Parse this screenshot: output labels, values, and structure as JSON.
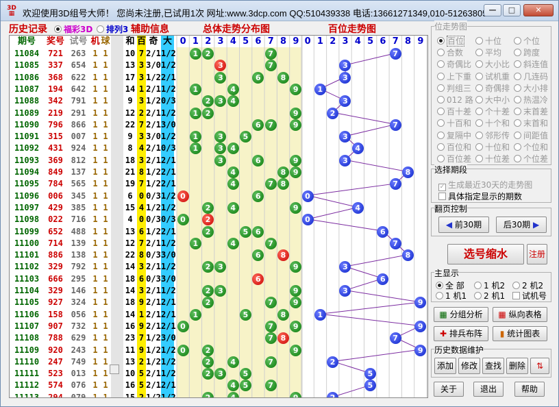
{
  "window": {
    "title": "欢迎使用3D组号大师！ 您尚未注册,已试用1次 网址:www.3dcp.com QQ:510439338 电话:13661271349,010-51263805",
    "logo": "3D",
    "min": "—",
    "max": "□",
    "close": "✕"
  },
  "headers": {
    "history": "历史记录",
    "fc3d": "福彩3D",
    "pl3": "排列3",
    "aux": "辅助信息",
    "overall": "总体走势分布图",
    "hundred": "百位走势图"
  },
  "columns": {
    "issue": "期号",
    "prize": "奖号",
    "trial": "试号",
    "machine": "机",
    "ball": "球",
    "sum": "和",
    "hundred": "百",
    "odd": "奇",
    "big": "大",
    "digits": [
      "0",
      "1",
      "2",
      "3",
      "4",
      "5",
      "6",
      "7",
      "8",
      "9"
    ]
  },
  "rows": [
    {
      "issue": "11084",
      "prize": "721",
      "trial": "263",
      "m": "1",
      "b": "1",
      "sum": "10",
      "h": "7",
      "odd": "2/1",
      "big": "1/2",
      "balls": [
        1,
        2,
        7
      ],
      "red": [],
      "hp": 7,
      "hh": 3
    },
    {
      "issue": "11085",
      "prize": "337",
      "trial": "654",
      "m": "1",
      "b": "1",
      "sum": "13",
      "h": "3",
      "odd": "3/0",
      "big": "1/2",
      "balls": [
        3,
        7
      ],
      "red": [
        3
      ],
      "hp": 3,
      "hh": 0
    },
    {
      "issue": "11086",
      "prize": "368",
      "trial": "622",
      "m": "1",
      "b": "1",
      "sum": "17",
      "h": "3",
      "odd": "1/2",
      "big": "2/1",
      "balls": [
        3,
        6,
        8
      ],
      "red": [],
      "hp": 3,
      "hh": 0
    },
    {
      "issue": "11087",
      "prize": "194",
      "trial": "642",
      "m": "1",
      "b": "1",
      "sum": "14",
      "h": "1",
      "odd": "2/1",
      "big": "1/2",
      "balls": [
        1,
        4,
        9
      ],
      "red": [],
      "hp": 1,
      "hh": 0
    },
    {
      "issue": "11088",
      "prize": "342",
      "trial": "791",
      "m": "1",
      "b": "1",
      "sum": "9",
      "h": "3",
      "odd": "1/2",
      "big": "0/3",
      "balls": [
        2,
        3,
        4
      ],
      "red": [],
      "hp": 3,
      "hh": 0
    },
    {
      "issue": "11089",
      "prize": "219",
      "trial": "291",
      "m": "1",
      "b": "1",
      "sum": "12",
      "h": "2",
      "odd": "2/1",
      "big": "1/2",
      "balls": [
        1,
        2,
        9
      ],
      "red": [],
      "hp": 2,
      "hh": 0
    },
    {
      "issue": "11090",
      "prize": "796",
      "trial": "866",
      "m": "1",
      "b": "1",
      "sum": "22",
      "h": "7",
      "odd": "2/1",
      "big": "3/0",
      "balls": [
        6,
        7,
        9
      ],
      "red": [],
      "hp": 7,
      "hh": 0
    },
    {
      "issue": "11091",
      "prize": "315",
      "trial": "007",
      "m": "1",
      "b": "1",
      "sum": "9",
      "h": "3",
      "odd": "3/0",
      "big": "1/2",
      "balls": [
        1,
        3,
        5
      ],
      "red": [],
      "hp": 3,
      "hh": 0
    },
    {
      "issue": "11092",
      "prize": "431",
      "trial": "924",
      "m": "1",
      "b": "1",
      "sum": "8",
      "h": "4",
      "odd": "2/1",
      "big": "0/3",
      "balls": [
        1,
        3,
        4
      ],
      "red": [],
      "hp": 4,
      "hh": 0
    },
    {
      "issue": "11093",
      "prize": "369",
      "trial": "812",
      "m": "1",
      "b": "1",
      "sum": "18",
      "h": "3",
      "odd": "2/1",
      "big": "2/1",
      "balls": [
        3,
        6,
        9
      ],
      "red": [],
      "hp": 3,
      "hh": 0
    },
    {
      "issue": "11094",
      "prize": "849",
      "trial": "137",
      "m": "1",
      "b": "1",
      "sum": "21",
      "h": "8",
      "odd": "1/2",
      "big": "2/1",
      "balls": [
        4,
        8,
        9
      ],
      "red": [],
      "hp": 8,
      "hh": 0
    },
    {
      "issue": "11095",
      "prize": "784",
      "trial": "565",
      "m": "1",
      "b": "1",
      "sum": "19",
      "h": "7",
      "odd": "1/2",
      "big": "2/1",
      "balls": [
        4,
        7,
        8
      ],
      "red": [],
      "hp": 7,
      "hh": 0
    },
    {
      "issue": "11096",
      "prize": "006",
      "trial": "345",
      "m": "1",
      "b": "1",
      "sum": "6",
      "h": "0",
      "odd": "0/3",
      "big": "1/2",
      "balls": [
        0,
        6
      ],
      "red": [
        0
      ],
      "hp": 0,
      "hh": 0
    },
    {
      "issue": "11097",
      "prize": "429",
      "trial": "385",
      "m": "1",
      "b": "1",
      "sum": "15",
      "h": "4",
      "odd": "1/2",
      "big": "1/2",
      "balls": [
        2,
        4,
        9
      ],
      "red": [],
      "hp": 4,
      "hh": 0
    },
    {
      "issue": "11098",
      "prize": "022",
      "trial": "716",
      "m": "1",
      "b": "1",
      "sum": "4",
      "h": "0",
      "odd": "0/3",
      "big": "0/3",
      "balls": [
        0,
        2
      ],
      "red": [
        2
      ],
      "hp": 0,
      "hh": 0
    },
    {
      "issue": "11099",
      "prize": "652",
      "trial": "488",
      "m": "1",
      "b": "1",
      "sum": "13",
      "h": "6",
      "odd": "1/2",
      "big": "2/1",
      "balls": [
        2,
        5,
        6
      ],
      "red": [],
      "hp": 6,
      "hh": 0
    },
    {
      "issue": "11100",
      "prize": "714",
      "trial": "139",
      "m": "1",
      "b": "1",
      "sum": "12",
      "h": "7",
      "odd": "2/1",
      "big": "1/2",
      "balls": [
        1,
        4,
        7
      ],
      "red": [],
      "hp": 7,
      "hh": 0
    },
    {
      "issue": "11101",
      "prize": "886",
      "trial": "138",
      "m": "1",
      "b": "1",
      "sum": "22",
      "h": "8",
      "odd": "0/3",
      "big": "3/0",
      "balls": [
        6,
        8
      ],
      "red": [
        8
      ],
      "hp": 8,
      "hh": 0
    },
    {
      "issue": "11102",
      "prize": "329",
      "trial": "792",
      "m": "1",
      "b": "1",
      "sum": "14",
      "h": "3",
      "odd": "2/1",
      "big": "1/2",
      "balls": [
        2,
        3,
        9
      ],
      "red": [],
      "hp": 3,
      "hh": 0
    },
    {
      "issue": "11103",
      "prize": "666",
      "trial": "295",
      "m": "1",
      "b": "1",
      "sum": "18",
      "h": "6",
      "odd": "0/3",
      "big": "3/0",
      "balls": [
        6
      ],
      "red": [
        6
      ],
      "hp": 6,
      "hh": 0
    },
    {
      "issue": "11104",
      "prize": "329",
      "trial": "146",
      "m": "1",
      "b": "1",
      "sum": "14",
      "h": "3",
      "odd": "2/1",
      "big": "1/2",
      "balls": [
        2,
        3,
        9
      ],
      "red": [],
      "hp": 3,
      "hh": 0
    },
    {
      "issue": "11105",
      "prize": "927",
      "trial": "324",
      "m": "1",
      "b": "1",
      "sum": "18",
      "h": "9",
      "odd": "2/1",
      "big": "2/1",
      "balls": [
        2,
        7,
        9
      ],
      "red": [],
      "hp": 9,
      "hh": 0
    },
    {
      "issue": "11106",
      "prize": "158",
      "trial": "056",
      "m": "1",
      "b": "1",
      "sum": "14",
      "h": "1",
      "odd": "2/1",
      "big": "2/1",
      "balls": [
        1,
        5,
        8
      ],
      "red": [],
      "hp": 1,
      "hh": 0
    },
    {
      "issue": "11107",
      "prize": "907",
      "trial": "732",
      "m": "1",
      "b": "1",
      "sum": "16",
      "h": "9",
      "odd": "2/1",
      "big": "2/1",
      "balls": [
        0,
        7,
        9
      ],
      "red": [],
      "hp": 9,
      "hh": 0
    },
    {
      "issue": "11108",
      "prize": "788",
      "trial": "629",
      "m": "1",
      "b": "1",
      "sum": "23",
      "h": "7",
      "odd": "1/2",
      "big": "3/0",
      "balls": [
        7,
        8
      ],
      "red": [
        8
      ],
      "hp": 7,
      "hh": 0
    },
    {
      "issue": "11109",
      "prize": "920",
      "trial": "243",
      "m": "1",
      "b": "1",
      "sum": "11",
      "h": "9",
      "odd": "1/2",
      "big": "1/2",
      "balls": [
        0,
        2,
        9
      ],
      "red": [],
      "hp": 9,
      "hh": 0
    },
    {
      "issue": "11110",
      "prize": "247",
      "trial": "749",
      "m": "1",
      "b": "1",
      "sum": "13",
      "h": "2",
      "odd": "1/2",
      "big": "1/2",
      "balls": [
        2,
        4,
        7
      ],
      "red": [],
      "hp": 2,
      "hh": 0
    },
    {
      "issue": "11111",
      "prize": "523",
      "trial": "013",
      "m": "1",
      "b": "1",
      "sum": "10",
      "h": "5",
      "odd": "2/1",
      "big": "1/2",
      "balls": [
        2,
        3,
        5
      ],
      "red": [],
      "hp": 5,
      "hh": 0
    },
    {
      "issue": "11112",
      "prize": "574",
      "trial": "076",
      "m": "1",
      "b": "1",
      "sum": "16",
      "h": "5",
      "odd": "2/1",
      "big": "2/1",
      "balls": [
        4,
        5,
        7
      ],
      "red": [],
      "hp": 5,
      "hh": 0
    },
    {
      "issue": "11113",
      "prize": "294",
      "trial": "079",
      "m": "1",
      "b": "1",
      "sum": "15",
      "h": "2",
      "odd": "1/2",
      "big": "1/2",
      "balls": [
        2,
        4,
        9
      ],
      "red": [],
      "hp": 2,
      "hh": 0
    }
  ],
  "position_panel": {
    "title": "位走势图",
    "options": [
      "百位",
      "十位",
      "个位",
      "合数",
      "平均",
      "跨度",
      "奇偶比",
      "大小比",
      "斜连值",
      "上下重",
      "试机重",
      "几连码",
      "判组三",
      "奇偶排",
      "大小排",
      "012 路",
      "大中小",
      "热温冷",
      "百十差",
      "个十差",
      "末首差",
      "十百和",
      "十个和",
      "末首和",
      "复隔中",
      "邻形传",
      "间距值",
      "百位和",
      "十位和",
      "个位和",
      "百位差",
      "十位差",
      "个位差"
    ],
    "selected": "百位"
  },
  "period_panel": {
    "title": "选择期段",
    "opt1": "生成最近30天的走势图",
    "opt2": "具体指定显示的期数"
  },
  "page_panel": {
    "title": "翻页控制",
    "prev": "前30期",
    "next": "后30期"
  },
  "actions": {
    "compress": "选号缩水",
    "register": "注册"
  },
  "display_panel": {
    "title": "主显示",
    "options": [
      "全 部",
      "1 机2",
      "2 机2",
      "1 机1",
      "2 机1",
      "试机号"
    ]
  },
  "tools": {
    "group": "分组分析",
    "vertical": "纵向表格",
    "arrange": "排兵布阵",
    "stats": "统计图表"
  },
  "maint_panel": {
    "title": "历史数据维护",
    "add": "添加",
    "edit": "修改",
    "find": "查找",
    "delete": "删除"
  },
  "bottom": {
    "about": "关于",
    "exit": "退出",
    "help": "帮助"
  },
  "colors": {
    "prize": "#cc0000",
    "issue": "#006600",
    "trial": "#333333",
    "hundred_bg": "#ffee00",
    "big_bg": "#33ccff",
    "grid_bg": "#f7f3c8"
  }
}
